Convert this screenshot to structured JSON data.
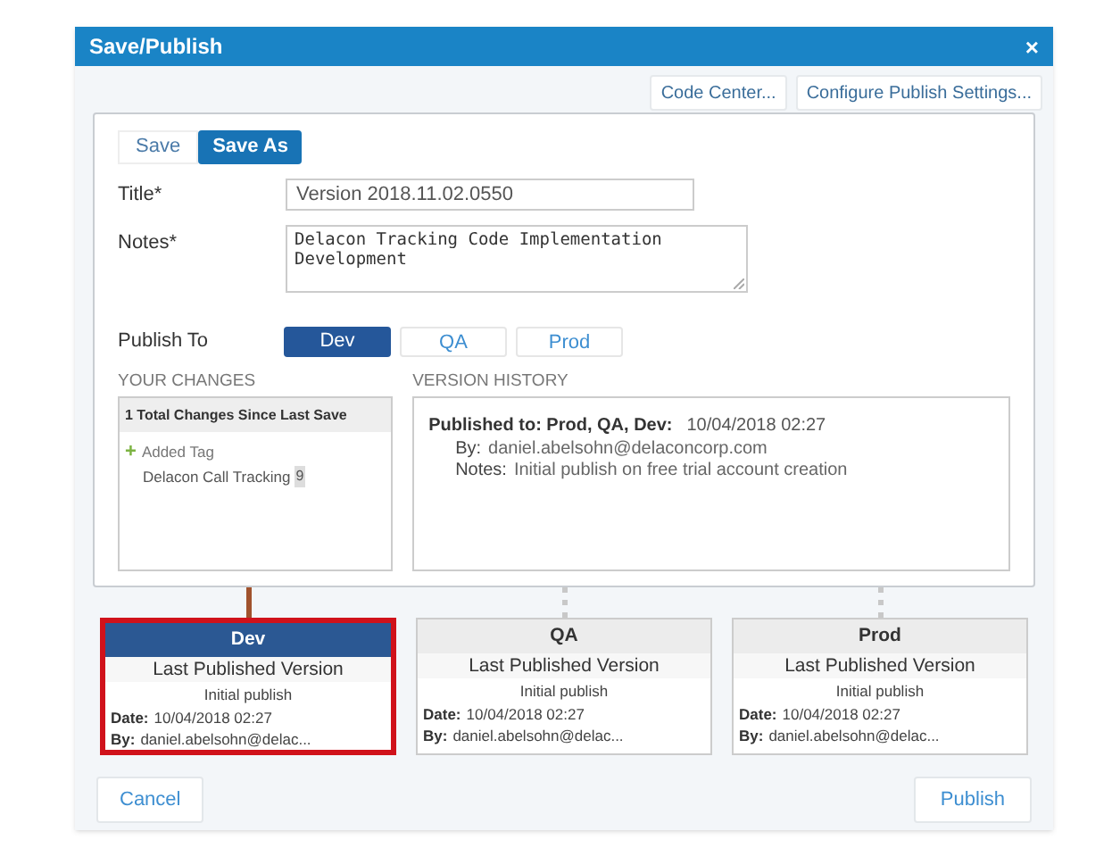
{
  "window": {
    "title": "Save/Publish",
    "close": "×"
  },
  "toolbar": [
    "Code Center...",
    "Configure Publish Settings..."
  ],
  "tabs": [
    {
      "label": "Save",
      "selected": false
    },
    {
      "label": "Save As",
      "selected": true
    }
  ],
  "form": {
    "title_label": "Title*",
    "title_value": "Version 2018.11.02.0550",
    "notes_label": "Notes*",
    "notes_value": "Delacon Tracking Code Implementation\nDevelopment",
    "publish_to_label": "Publish To"
  },
  "publish_to": [
    {
      "label": "Dev",
      "selected": true
    },
    {
      "label": "QA",
      "selected": false
    },
    {
      "label": "Prod",
      "selected": false
    }
  ],
  "your_changes": {
    "heading": "YOUR CHANGES",
    "summary": "1 Total Changes Since Last Save",
    "items": [
      {
        "icon": "+",
        "action": "Added Tag",
        "name": "Delacon Call Tracking",
        "count": "9"
      }
    ]
  },
  "version_history": {
    "heading": "VERSION HISTORY",
    "entries": [
      {
        "published_label": "Published to: Prod, QA, Dev:",
        "date": "10/04/2018 02:27",
        "by_label": "By:",
        "by": "daniel.abelsohn@delaconcorp.com",
        "notes_label": "Notes:",
        "notes": "Initial publish on free trial account creation"
      }
    ]
  },
  "environments": [
    {
      "name": "Dev",
      "selected": true,
      "subtitle": "Last Published Version",
      "note": "Initial publish",
      "date_label": "Date:",
      "date": "10/04/2018 02:27",
      "by_label": "By:",
      "by": "daniel.abelsohn@delac..."
    },
    {
      "name": "QA",
      "selected": false,
      "subtitle": "Last Published Version",
      "note": "Initial publish",
      "date_label": "Date:",
      "date": "10/04/2018 02:27",
      "by_label": "By:",
      "by": "daniel.abelsohn@delac..."
    },
    {
      "name": "Prod",
      "selected": false,
      "subtitle": "Last Published Version",
      "note": "Initial publish",
      "date_label": "Date:",
      "date": "10/04/2018 02:27",
      "by_label": "By:",
      "by": "daniel.abelsohn@delac..."
    }
  ],
  "footer": {
    "cancel": "Cancel",
    "publish": "Publish"
  }
}
